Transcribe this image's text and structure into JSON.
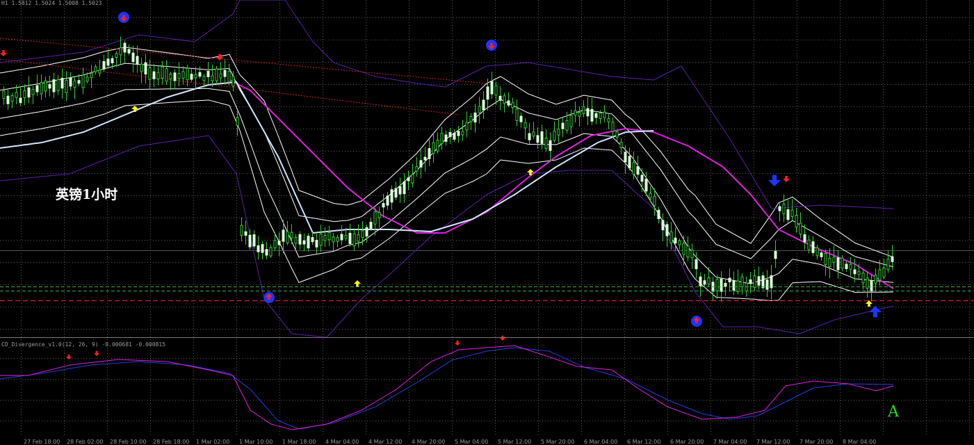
{
  "header": {
    "main": "H1  1.5812 1.5024 1.5008 1.5023",
    "indicator": "CD_Divergence_v1.0(12, 26, 9) -0.000681 -0.000815"
  },
  "annotation": "英镑1小时",
  "corner_label": "A",
  "colors": {
    "background": "#000000",
    "grid": "#5a5a5a",
    "candle": "#d8ffd8",
    "wick": "#33cc33",
    "bands": "#ffffff",
    "outer_bands": "#5b1fa8",
    "ma_pink": "#e020e0",
    "ma_light": "#cfe6ff",
    "macd": "#e020e0",
    "signal": "#2040e0",
    "arrow_up_yellow": "#ffff00",
    "arrow_down_red": "#ff2020",
    "arrow_blue": "#1a36ff",
    "level_green": "#40aa40",
    "level_red": "#ff2020"
  },
  "chart_data": {
    "type": "line",
    "x_ticks": [
      "27 Feb 18:00",
      "28 Feb 02:00",
      "28 Feb 10:00",
      "28 Feb 18:00",
      "1 Mar 02:00",
      "1 Mar 10:00",
      "1 Mar 18:00",
      "4 Mar 04:00",
      "4 Mar 12:00",
      "4 Mar 20:00",
      "5 Mar 04:00",
      "5 Mar 12:00",
      "5 Mar 20:00",
      "6 Mar 04:00",
      "6 Mar 12:00",
      "6 Mar 20:00",
      "7 Mar 04:00",
      "7 Mar 12:00",
      "7 Mar 20:00",
      "8 Mar 04:00"
    ]
  }
}
